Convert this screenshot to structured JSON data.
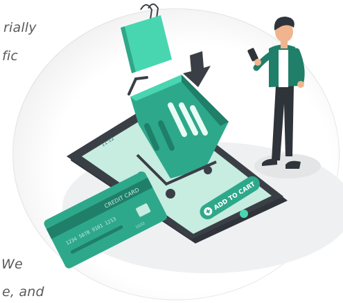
{
  "text_fragments": {
    "top_line_1": "rially",
    "top_line_2": "fic",
    "bottom_line_1": "We",
    "bottom_line_2": "e, and"
  },
  "phone": {
    "status_time": "11:12",
    "add_to_cart_label": "ADD TO CART"
  },
  "credit_card": {
    "title": "CREDIT CARD",
    "number": "1234  5678  9101  1213",
    "expiry": "12/22"
  },
  "icons": [
    "shopping-bag-icon",
    "down-arrow-icon",
    "shopping-cart-icon",
    "cart-plus-icon"
  ],
  "colors": {
    "accent": "#2ea88a",
    "accent_light": "#48d6b1",
    "accent_dark": "#1f7f69",
    "phone_body": "#3a3f46",
    "phone_screen": "#c7ece0"
  }
}
